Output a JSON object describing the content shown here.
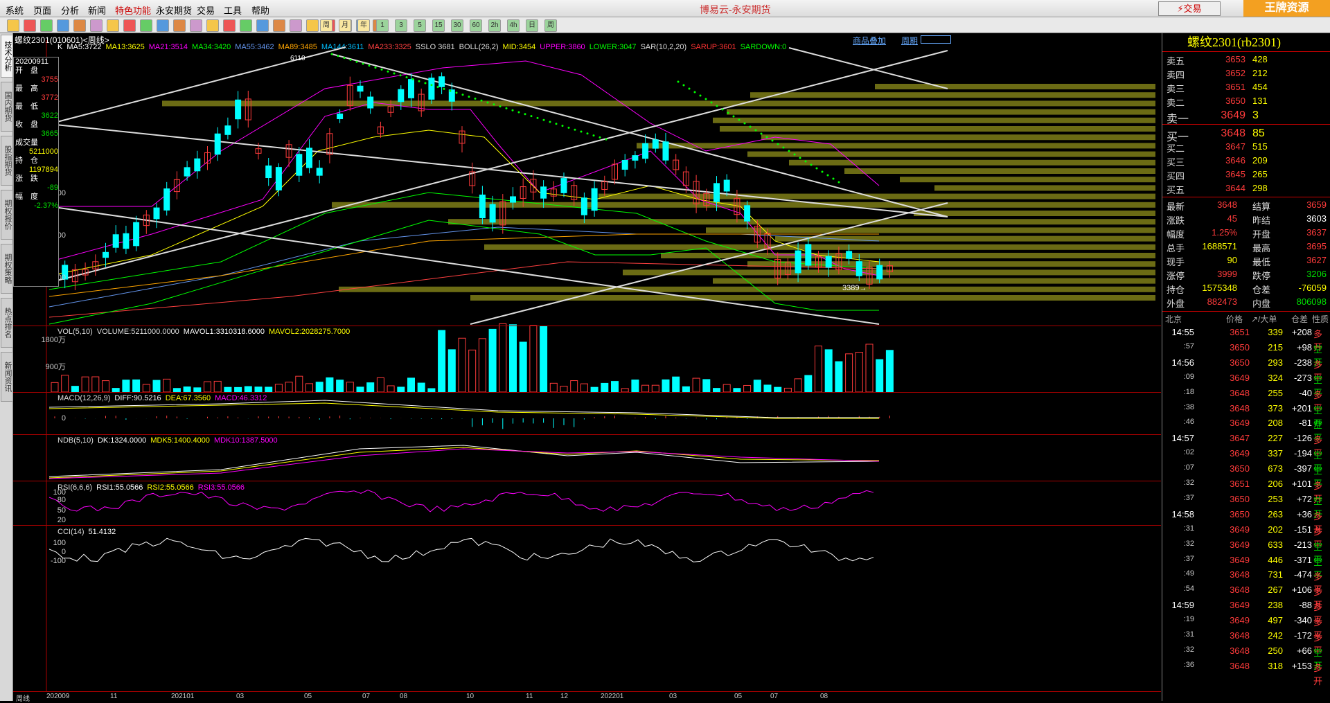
{
  "menu": {
    "items": [
      "系统",
      "页面",
      "分析",
      "新闻",
      "特色功能",
      "永安期货",
      "交易",
      "工具",
      "帮助"
    ],
    "window_title": "博易云-永安期货",
    "trade_btn": "⚡交易",
    "watermark": "王牌资源5etz.com"
  },
  "toolbar": {
    "labels": [
      "周",
      "月",
      "年",
      "1",
      "3",
      "5",
      "15",
      "30",
      "60",
      "2h",
      "4h",
      "日",
      "周"
    ]
  },
  "sidebar": {
    "tabs": [
      "技术分析",
      "国内期货",
      "股指期货",
      "期权报价",
      "期权策略",
      "热点排名",
      "新闻资讯"
    ]
  },
  "chart": {
    "title": "螺纹2301(010601)<周线>",
    "links": [
      "商品叠加",
      "周期"
    ],
    "main_indicators": [
      {
        "text": "K",
        "color": "#ffffff"
      },
      {
        "text": "MA5:3722",
        "color": "#ffffff"
      },
      {
        "text": "MA13:3625",
        "color": "#ffff00"
      },
      {
        "text": "MA21:3514",
        "color": "#ff00ff"
      },
      {
        "text": "MA34:3420",
        "color": "#00ff00"
      },
      {
        "text": "MA55:3462",
        "color": "#6495ed"
      },
      {
        "text": "MA89:3485",
        "color": "#ffa500"
      },
      {
        "text": "MA144:3611",
        "color": "#00bfff"
      },
      {
        "text": "MA233:3325",
        "color": "#ff4040"
      },
      {
        "text": "SSLO 3681",
        "color": "#dddddd"
      },
      {
        "text": "BOLL(26,2)",
        "color": "#dddddd"
      },
      {
        "text": "MID:3454",
        "color": "#ffff00"
      },
      {
        "text": "UPPER:3860",
        "color": "#ff00ff"
      },
      {
        "text": "LOWER:3047",
        "color": "#00ff00"
      },
      {
        "text": "SAR(10,2,20)",
        "color": "#dddddd"
      },
      {
        "text": "SARUP:3601",
        "color": "#ff3333"
      },
      {
        "text": "SARDOWN:0",
        "color": "#00ff00"
      }
    ],
    "price_axis": [
      "4500",
      "4000",
      "3500"
    ],
    "annotations": {
      "high": "6110",
      "low": "3389→"
    },
    "infobox": {
      "date": "20200911",
      "open_label": "开　盘",
      "open": "3755",
      "high_label": "最　高",
      "high": "3772",
      "low_label": "最　低",
      "low": "3622",
      "close_label": "收　盘",
      "close": "3665",
      "vol_label": "成交量",
      "vol": "5211000",
      "oi_label": "持　仓",
      "oi": "1197894",
      "chg_label": "涨　跌",
      "chg": "-89",
      "amp_label": "幅　度",
      "amp": "-2.37%"
    },
    "vol_panel": {
      "header": [
        {
          "text": "VOL(5,10)",
          "color": "#dddddd"
        },
        {
          "text": "VOLUME:5211000.0000",
          "color": "#dddddd"
        },
        {
          "text": "MAVOL1:3310318.6000",
          "color": "#ffffff"
        },
        {
          "text": "MAVOL2:2028275.7000",
          "color": "#ffff00"
        }
      ],
      "axis": [
        "1800万",
        "900万"
      ]
    },
    "macd_panel": {
      "header": [
        {
          "text": "MACD(12,26,9)",
          "color": "#dddddd"
        },
        {
          "text": "DIFF:90.5216",
          "color": "#ffffff"
        },
        {
          "text": "DEA:67.3560",
          "color": "#ffff00"
        },
        {
          "text": "MACD:46.3312",
          "color": "#ff00ff"
        }
      ],
      "axis": [
        "0"
      ]
    },
    "ndb_panel": {
      "header": [
        {
          "text": "NDB(5,10)",
          "color": "#dddddd"
        },
        {
          "text": "DK:1324.0000",
          "color": "#ffffff"
        },
        {
          "text": "MDK5:1400.4000",
          "color": "#ffff00"
        },
        {
          "text": "MDK10:1387.5000",
          "color": "#ff00ff"
        }
      ]
    },
    "rsi_panel": {
      "header": [
        {
          "text": "RSI(6,6,6)",
          "color": "#dddddd"
        },
        {
          "text": "RSI1:55.0566",
          "color": "#ffffff"
        },
        {
          "text": "RSI2:55.0566",
          "color": "#ffff00"
        },
        {
          "text": "RSI3:55.0566",
          "color": "#ff00ff"
        }
      ],
      "axis": [
        "100",
        "80",
        "50",
        "20"
      ]
    },
    "cci_panel": {
      "header": [
        {
          "text": "CCI(14)",
          "color": "#dddddd"
        },
        {
          "text": "51.4132",
          "color": "#ffffff"
        }
      ],
      "axis": [
        "100",
        "0",
        "-100"
      ]
    },
    "date_axis": [
      "周线",
      "202009",
      "11",
      "202101",
      "03",
      "05",
      "07",
      "08",
      "10",
      "11",
      "12",
      "202201",
      "03",
      "05",
      "07",
      "08",
      "10"
    ]
  },
  "quote": {
    "title": "螺纹2301(rb2301)",
    "asks": [
      {
        "label": "卖五",
        "price": "3653",
        "vol": "428"
      },
      {
        "label": "卖四",
        "price": "3652",
        "vol": "212"
      },
      {
        "label": "卖三",
        "price": "3651",
        "vol": "454"
      },
      {
        "label": "卖二",
        "price": "3650",
        "vol": "131"
      },
      {
        "label": "卖一",
        "price": "3649",
        "vol": "3"
      }
    ],
    "bids": [
      {
        "label": "买一",
        "price": "3648",
        "vol": "85"
      },
      {
        "label": "买二",
        "price": "3647",
        "vol": "515"
      },
      {
        "label": "买三",
        "price": "3646",
        "vol": "209"
      },
      {
        "label": "买四",
        "price": "3645",
        "vol": "265"
      },
      {
        "label": "买五",
        "price": "3644",
        "vol": "298"
      }
    ],
    "stats": [
      {
        "a": "最新",
        "b": "3648",
        "bc": "#ff3b3b",
        "c": "结算",
        "d": "3659",
        "dc": "#ff3b3b"
      },
      {
        "a": "涨跌",
        "b": "45",
        "bc": "#ff3b3b",
        "c": "昨结",
        "d": "3603",
        "dc": "#ffffff"
      },
      {
        "a": "幅度",
        "b": "1.25%",
        "bc": "#ff3b3b",
        "c": "开盘",
        "d": "3637",
        "dc": "#ff3b3b"
      },
      {
        "a": "总手",
        "b": "1688571",
        "bc": "#ffff00",
        "c": "最高",
        "d": "3695",
        "dc": "#ff3b3b"
      },
      {
        "a": "现手",
        "b": "90",
        "bc": "#ffff00",
        "c": "最低",
        "d": "3627",
        "dc": "#ff3b3b"
      },
      {
        "a": "涨停",
        "b": "3999",
        "bc": "#ff3b3b",
        "c": "跌停",
        "d": "3206",
        "dc": "#00e000"
      },
      {
        "a": "持仓",
        "b": "1575348",
        "bc": "#ffff00",
        "c": "仓差",
        "d": "-76059",
        "dc": "#ffff00"
      },
      {
        "a": "外盘",
        "b": "882473",
        "bc": "#ff3b3b",
        "c": "内盘",
        "d": "806098",
        "dc": "#00e000"
      }
    ],
    "ticks_header": {
      "loc": "北京",
      "price": "价格",
      "vol": "↗/大单",
      "ch": "仓差",
      "type": "性质"
    },
    "ticks": [
      {
        "t": "14:55",
        "p": "3651",
        "pc": "#ff3b3b",
        "v": "339",
        "c": "+208",
        "cc": "#ffffff",
        "ty": "多开",
        "tc": "#ff3b3b",
        "big": true
      },
      {
        "t": ":57",
        "p": "3650",
        "pc": "#ff3b3b",
        "v": "215",
        "c": "+98",
        "cc": "#ffffff",
        "ty": "空开",
        "tc": "#00e000",
        "big": false
      },
      {
        "t": "14:56",
        "p": "3650",
        "pc": "#ff3b3b",
        "v": "293",
        "c": "-238",
        "cc": "#ffffff",
        "ty": "多平",
        "tc": "#ff3b3b",
        "big": true
      },
      {
        "t": ":09",
        "p": "3649",
        "pc": "#ff3b3b",
        "v": "324",
        "c": "-273",
        "cc": "#ffffff",
        "ty": "空平",
        "tc": "#00e000",
        "big": false
      },
      {
        "t": ":18",
        "p": "3648",
        "pc": "#ff3b3b",
        "v": "255",
        "c": "-40",
        "cc": "#ffffff",
        "ty": "多平",
        "tc": "#ff3b3b",
        "big": false
      },
      {
        "t": ":38",
        "p": "3648",
        "pc": "#ff3b3b",
        "v": "373",
        "c": "+201",
        "cc": "#ffffff",
        "ty": "空开",
        "tc": "#00e000",
        "big": false
      },
      {
        "t": ":46",
        "p": "3649",
        "pc": "#ff3b3b",
        "v": "208",
        "c": "-81",
        "cc": "#ffffff",
        "ty": "空平",
        "tc": "#00e000",
        "big": false
      },
      {
        "t": "14:57",
        "p": "3647",
        "pc": "#ff3b3b",
        "v": "227",
        "c": "-126",
        "cc": "#ffffff",
        "ty": "多平",
        "tc": "#ff3b3b",
        "big": true
      },
      {
        "t": ":02",
        "p": "3649",
        "pc": "#ff3b3b",
        "v": "337",
        "c": "-194",
        "cc": "#ffffff",
        "ty": "空平",
        "tc": "#00e000",
        "big": false
      },
      {
        "t": ":07",
        "p": "3650",
        "pc": "#ff3b3b",
        "v": "673",
        "c": "-397",
        "cc": "#ffffff",
        "ty": "空平",
        "tc": "#00e000",
        "big": false
      },
      {
        "t": ":32",
        "p": "3651",
        "pc": "#ff3b3b",
        "v": "206",
        "c": "+101",
        "cc": "#ffffff",
        "ty": "多开",
        "tc": "#ff3b3b",
        "big": false
      },
      {
        "t": ":37",
        "p": "3650",
        "pc": "#ff3b3b",
        "v": "253",
        "c": "+72",
        "cc": "#ffffff",
        "ty": "空开",
        "tc": "#00e000",
        "big": false
      },
      {
        "t": "14:58",
        "p": "3650",
        "pc": "#ff3b3b",
        "v": "263",
        "c": "+36",
        "cc": "#ffffff",
        "ty": "多开",
        "tc": "#ff3b3b",
        "big": true
      },
      {
        "t": ":31",
        "p": "3649",
        "pc": "#ff3b3b",
        "v": "202",
        "c": "-151",
        "cc": "#ffffff",
        "ty": "多平",
        "tc": "#ff3b3b",
        "big": false
      },
      {
        "t": ":32",
        "p": "3649",
        "pc": "#ff3b3b",
        "v": "633",
        "c": "-213",
        "cc": "#ffffff",
        "ty": "空平",
        "tc": "#00e000",
        "big": false
      },
      {
        "t": ":37",
        "p": "3649",
        "pc": "#ff3b3b",
        "v": "446",
        "c": "-371",
        "cc": "#ffffff",
        "ty": "空平",
        "tc": "#00e000",
        "big": false
      },
      {
        "t": ":49",
        "p": "3648",
        "pc": "#ff3b3b",
        "v": "731",
        "c": "-474",
        "cc": "#ffffff",
        "ty": "多平",
        "tc": "#ff3b3b",
        "big": false
      },
      {
        "t": ":54",
        "p": "3648",
        "pc": "#ff3b3b",
        "v": "267",
        "c": "+106",
        "cc": "#ffffff",
        "ty": "多开",
        "tc": "#ff3b3b",
        "big": false
      },
      {
        "t": "14:59",
        "p": "3649",
        "pc": "#ff3b3b",
        "v": "238",
        "c": "-88",
        "cc": "#ffffff",
        "ty": "多平",
        "tc": "#ff3b3b",
        "big": true
      },
      {
        "t": ":19",
        "p": "3649",
        "pc": "#ff3b3b",
        "v": "497",
        "c": "-340",
        "cc": "#ffffff",
        "ty": "多平",
        "tc": "#ff3b3b",
        "big": false
      },
      {
        "t": ":31",
        "p": "3648",
        "pc": "#ff3b3b",
        "v": "242",
        "c": "-172",
        "cc": "#ffffff",
        "ty": "多平",
        "tc": "#ff3b3b",
        "big": false
      },
      {
        "t": ":32",
        "p": "3648",
        "pc": "#ff3b3b",
        "v": "250",
        "c": "+66",
        "cc": "#ffffff",
        "ty": "空开",
        "tc": "#00e000",
        "big": false
      },
      {
        "t": ":36",
        "p": "3648",
        "pc": "#ff3b3b",
        "v": "318",
        "c": "+153",
        "cc": "#ffffff",
        "ty": "多开",
        "tc": "#ff3b3b",
        "big": false
      }
    ]
  },
  "colors": {
    "up": "#ff3b3b",
    "down": "#00ffff",
    "bg": "#000000",
    "grid": "#aa0000"
  }
}
